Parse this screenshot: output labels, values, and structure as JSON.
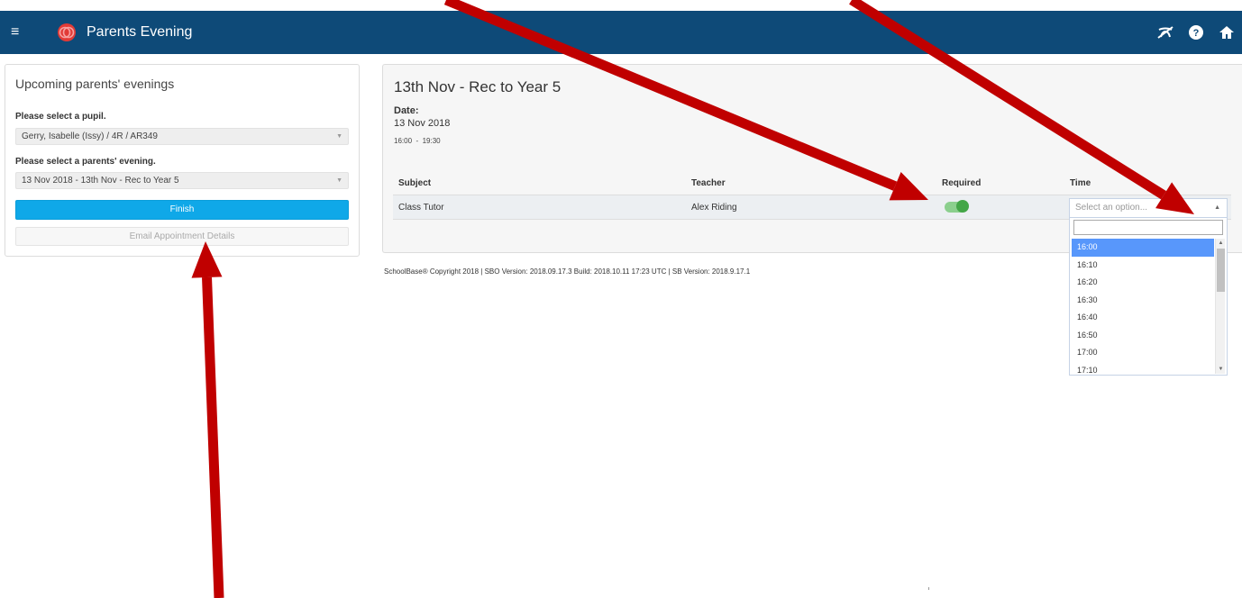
{
  "app": {
    "title": "Parents Evening",
    "menu_icon": "menu-icon",
    "logo_icon": "schoolbase-logo",
    "brand_color": "#0e4a78",
    "right_icons": [
      "no-swearing-ribbon-icon",
      "help-icon",
      "home-icon"
    ]
  },
  "sidebar": {
    "heading": "Upcoming parents' evenings",
    "pupil_label": "Please select a pupil.",
    "pupil_value": "Gerry, Isabelle (Issy) / 4R / AR349",
    "evening_label": "Please select a parents' evening.",
    "evening_value": "13 Nov 2018 - 13th Nov - Rec to Year 5",
    "finish_label": "Finish",
    "email_label": "Email Appointment Details",
    "finish_color": "#0fa8e8"
  },
  "main": {
    "title": "13th Nov - Rec to Year 5",
    "date_label": "Date:",
    "date_value": "13 Nov 2018",
    "time_range": "16:00  -  19:30",
    "columns": [
      "Subject",
      "Teacher",
      "Required",
      "Time"
    ],
    "rows": [
      {
        "subject": "Class Tutor",
        "teacher": "Alex Riding",
        "required": true
      }
    ],
    "time_placeholder": "Select an option...",
    "time_options": [
      "16:00",
      "16:10",
      "16:20",
      "16:30",
      "16:40",
      "16:50",
      "17:00",
      "17:10"
    ],
    "selected_option": "16:00",
    "toggle_color": "#43a647"
  },
  "footer": {
    "text": "SchoolBase® Copyright 2018 | SBO Version: 2018.09.17.3 Build: 2018.10.11 17:23 UTC | SB Version: 2018.9.17.1"
  },
  "annotations": {
    "arrow_color": "#c00000",
    "count": 4
  }
}
